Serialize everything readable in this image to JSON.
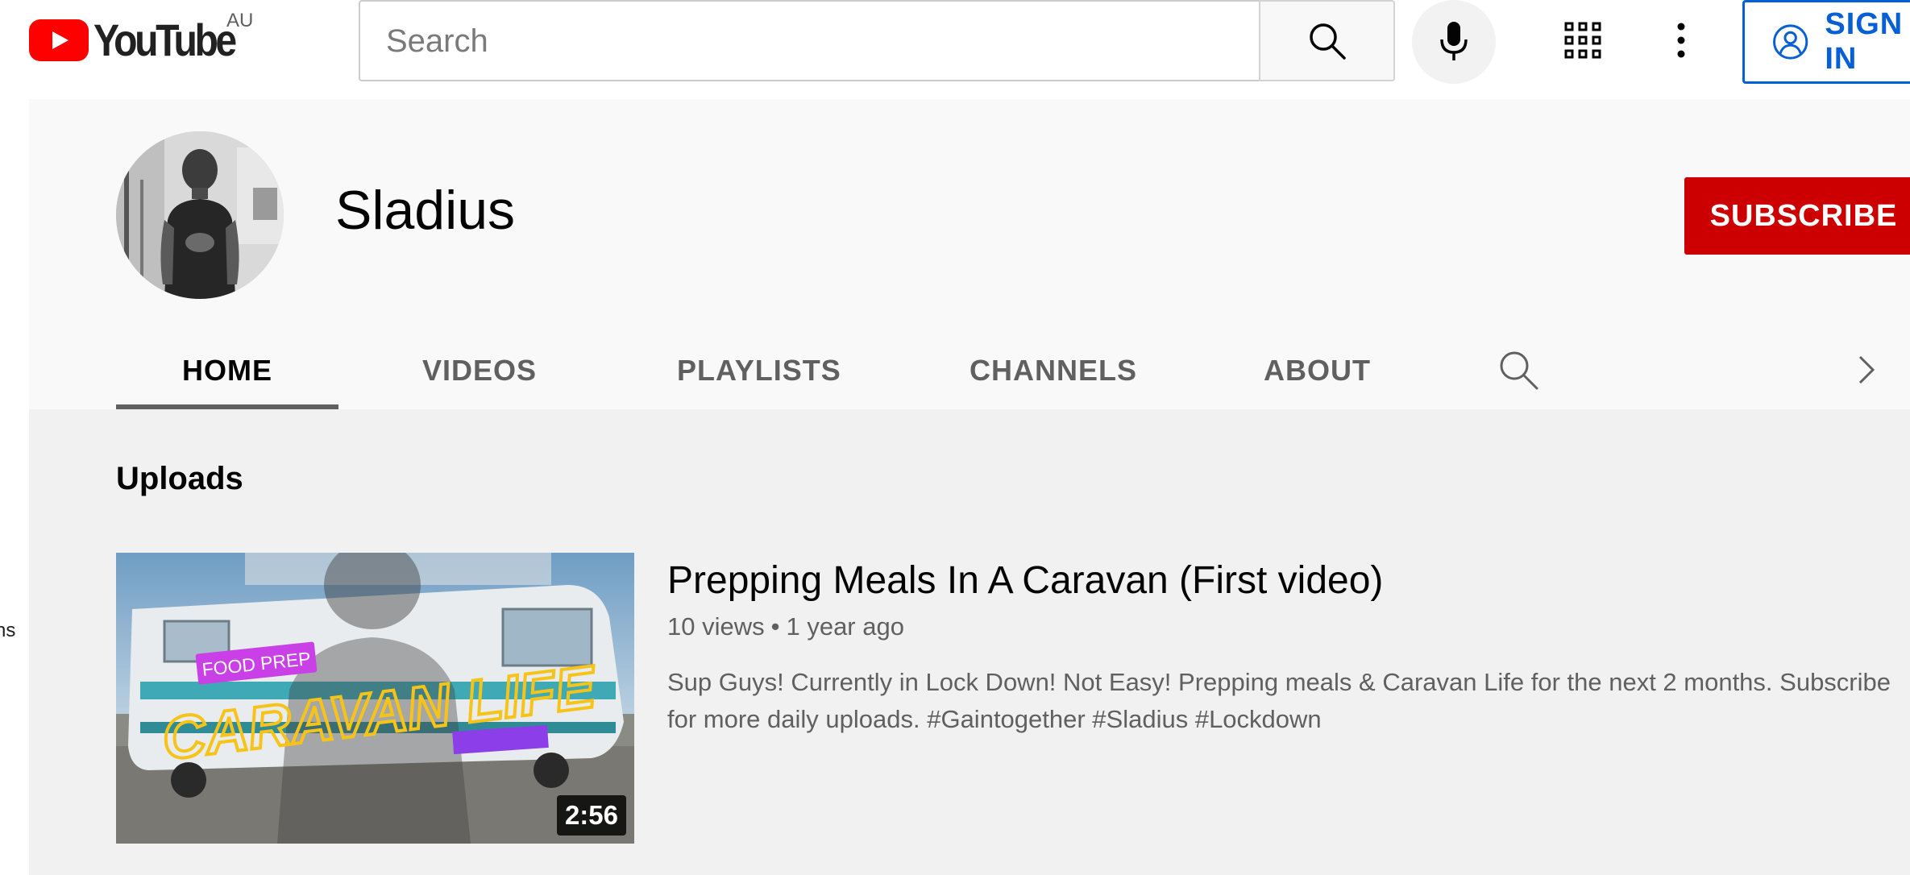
{
  "header": {
    "logo_text": "YouTube",
    "region": "AU",
    "search_placeholder": "Search",
    "signin_label": "SIGN IN",
    "icons": [
      "youtube-logo-icon",
      "search-icon",
      "microphone-icon",
      "apps-grid-icon",
      "more-vert-icon",
      "account-circle-icon"
    ]
  },
  "sidebar": {
    "partial_label": "ns"
  },
  "channel": {
    "name": "Sladius",
    "subscribe_label": "SUBSCRIBE",
    "tabs": [
      {
        "label": "HOME",
        "active": true
      },
      {
        "label": "VIDEOS",
        "active": false
      },
      {
        "label": "PLAYLISTS",
        "active": false
      },
      {
        "label": "CHANNELS",
        "active": false
      },
      {
        "label": "ABOUT",
        "active": false
      }
    ]
  },
  "uploads": {
    "section_title": "Uploads",
    "video": {
      "title": "Prepping Meals In A Caravan (First video)",
      "views": "10 views",
      "age": "1 year ago",
      "separator": "•",
      "description": "Sup Guys! Currently in Lock Down! Not Easy! Prepping meals & Caravan Life for the next 2 months. Subscribe for more daily uploads. #Gaintogether #Sladius #Lockdown",
      "duration": "2:56",
      "thumbnail_text": {
        "tag": "FOOD PREP",
        "headline": "CARAVAN LIFE"
      }
    }
  },
  "colors": {
    "brand_red": "#ff0000",
    "subscribe_bg": "#cc0000",
    "signin_blue": "#065fd4",
    "header_bg": "#f9f9f9",
    "content_bg": "#f1f1f1"
  }
}
